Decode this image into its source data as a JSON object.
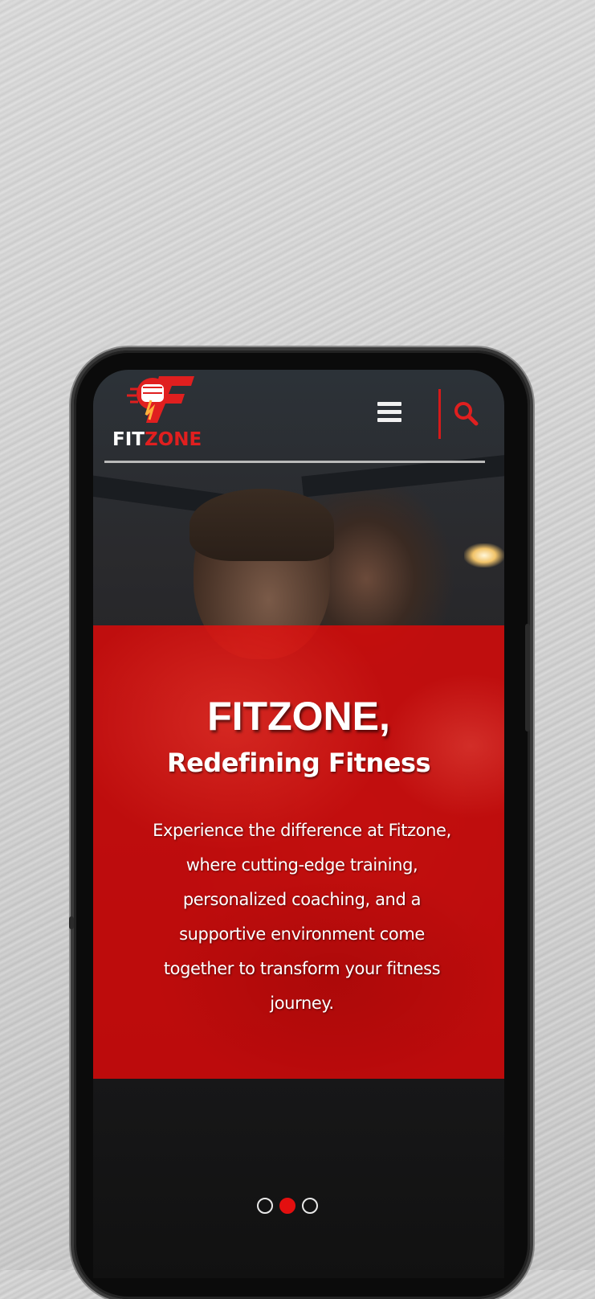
{
  "brand": {
    "logo_prefix": "FIT",
    "logo_suffix": "ZONE",
    "accent_color": "#e01f1f"
  },
  "header": {
    "menu_icon": "hamburger-menu-icon",
    "search_icon": "search-icon"
  },
  "hero": {
    "title": "FITZONE,",
    "subtitle": "Redefining Fitness",
    "body": "Experience the difference at Fitzone, where cutting-edge training, personalized coaching, and a supportive environment come together to transform your fitness journey."
  },
  "carousel": {
    "slide_count": 3,
    "active_index": 2
  }
}
